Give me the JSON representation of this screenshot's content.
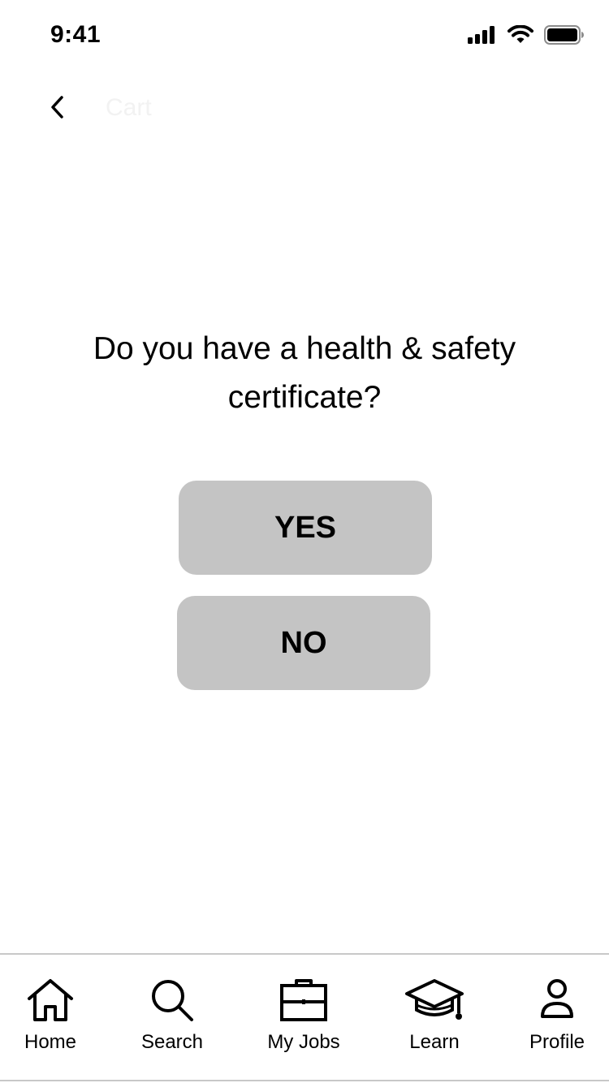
{
  "status_bar": {
    "time": "9:41",
    "icons": [
      "cellular-signal-icon",
      "wifi-icon",
      "battery-icon"
    ]
  },
  "nav": {
    "back_icon": "chevron-left-icon",
    "title": "Cart"
  },
  "question": {
    "text": "Do you have a health & safety certificate?"
  },
  "choices": {
    "yes_label": "YES",
    "no_label": "NO"
  },
  "tab_bar": {
    "tabs": [
      {
        "label": "Home",
        "icon": "home-icon"
      },
      {
        "label": "Search",
        "icon": "search-icon"
      },
      {
        "label": "My Jobs",
        "icon": "briefcase-icon"
      },
      {
        "label": "Learn",
        "icon": "graduation-cap-icon"
      },
      {
        "label": "Profile",
        "icon": "person-icon"
      }
    ]
  },
  "colors": {
    "button_bg": "#c4c4c4",
    "divider": "#c8c8c8",
    "nav_title": "#f2f2f2"
  }
}
